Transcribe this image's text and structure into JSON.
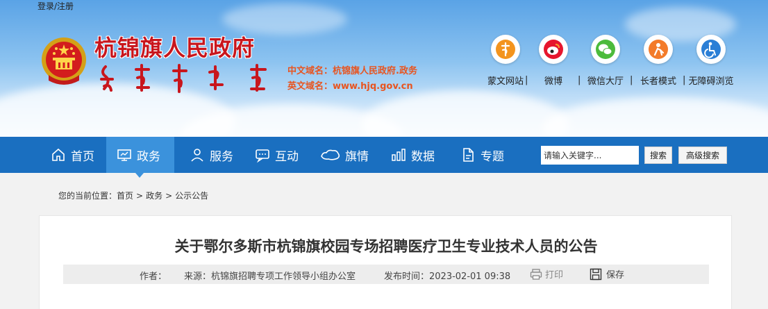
{
  "header": {
    "login_label": "登录/注册",
    "site_title": "杭锦旗人民政府",
    "domain_cn": "中文域名：杭锦旗人民政府.政务",
    "domain_en": "英文域名：www.hjq.gov.cn",
    "quick_links": [
      {
        "label": "蒙文网站",
        "icon": "mongolian-script-icon"
      },
      {
        "label": "微博",
        "icon": "weibo-icon"
      },
      {
        "label": "微信大厅",
        "icon": "wechat-icon"
      },
      {
        "label": "长者模式",
        "icon": "elder-icon"
      },
      {
        "label": "无障碍浏览",
        "icon": "accessibility-icon"
      }
    ],
    "separator": "|"
  },
  "nav": {
    "items": [
      {
        "label": "首页",
        "icon": "home-icon"
      },
      {
        "label": "政务",
        "icon": "monitor-icon",
        "active": true
      },
      {
        "label": "服务",
        "icon": "person-icon"
      },
      {
        "label": "互动",
        "icon": "chat-icon"
      },
      {
        "label": "旗情",
        "icon": "map-icon"
      },
      {
        "label": "数据",
        "icon": "bar-chart-icon"
      },
      {
        "label": "专题",
        "icon": "document-icon"
      }
    ],
    "search_placeholder": "请输入关键字...",
    "search_button": "搜索",
    "advanced_search_button": "高级搜索"
  },
  "breadcrumb": {
    "prefix": "您的当前位置：",
    "items": [
      "首页",
      "政务",
      "公示公告"
    ],
    "separator": ">"
  },
  "article": {
    "title": "关于鄂尔多斯市杭锦旗校园专场招聘医疗卫生专业技术人员的公告",
    "author_label": "作者：",
    "source": "来源：杭锦旗招聘专项工作领导小组办公室",
    "publish_time": "发布时间：2023-02-01 09:38",
    "print_label": "打印",
    "save_label": "保存"
  },
  "colors": {
    "title_red": "#c8161d",
    "domain_orange": "#e8541f",
    "nav_blue": "#1a6fc0",
    "nav_active": "#3b92dc",
    "elder_orange": "#f37b2a"
  }
}
